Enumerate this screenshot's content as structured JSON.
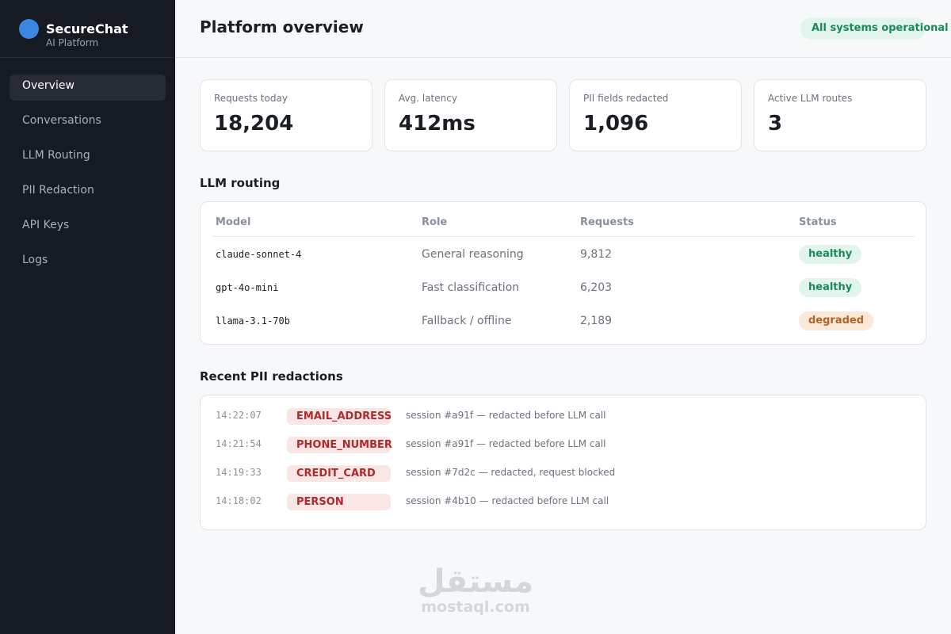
{
  "brand": {
    "name": "SecureChat",
    "subtitle": "AI Platform"
  },
  "sidebar": {
    "items": [
      {
        "label": "Overview",
        "active": true
      },
      {
        "label": "Conversations"
      },
      {
        "label": "LLM Routing"
      },
      {
        "label": "PII Redaction"
      },
      {
        "label": "API Keys"
      },
      {
        "label": "Logs"
      }
    ]
  },
  "header": {
    "title": "Platform overview",
    "status": "All systems operational"
  },
  "stats": [
    {
      "label": "Requests today",
      "value": "18,204"
    },
    {
      "label": "Avg. latency",
      "value": "412ms"
    },
    {
      "label": "PII fields redacted",
      "value": "1,096"
    },
    {
      "label": "Active LLM routes",
      "value": "3"
    }
  ],
  "routing": {
    "title": "LLM routing",
    "columns": [
      "Model",
      "Role",
      "Requests",
      "Status"
    ],
    "rows": [
      {
        "model": "claude-sonnet-4",
        "role": "General reasoning",
        "requests": "9,812",
        "status": "healthy"
      },
      {
        "model": "gpt-4o-mini",
        "role": "Fast classification",
        "requests": "6,203",
        "status": "healthy"
      },
      {
        "model": "llama-3.1-70b",
        "role": "Fallback / offline",
        "requests": "2,189",
        "status": "degraded"
      }
    ]
  },
  "redactions": {
    "title": "Recent PII redactions",
    "rows": [
      {
        "time": "14:22:07",
        "type": "EMAIL_ADDRESS",
        "desc": "session #a91f — redacted before LLM call"
      },
      {
        "time": "14:21:54",
        "type": "PHONE_NUMBER",
        "desc": "session #a91f — redacted before LLM call"
      },
      {
        "time": "14:19:33",
        "type": "CREDIT_CARD",
        "desc": "session #7d2c — redacted, request blocked"
      },
      {
        "time": "14:18:02",
        "type": "PERSON",
        "desc": "session #4b10 — redacted before LLM call"
      }
    ]
  },
  "watermark": {
    "main": "مستقل",
    "sub": "mostaql.com"
  },
  "colors": {
    "accent": "#3a86e0",
    "healthy": "#1b8a5a",
    "degraded": "#b0632a",
    "pii": "#b02a2a",
    "sidebar": "#161a23"
  }
}
